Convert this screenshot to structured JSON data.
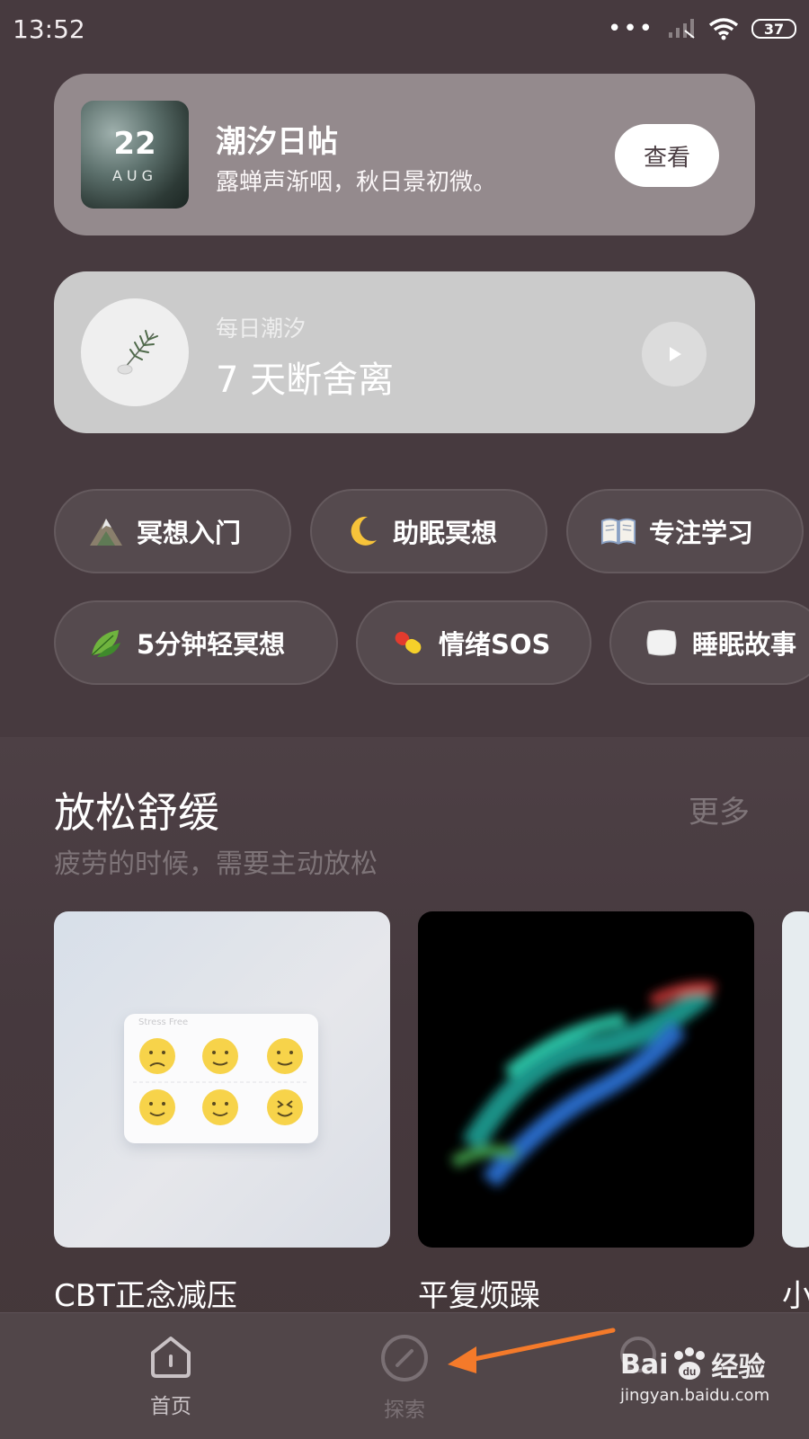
{
  "status": {
    "time": "13:52",
    "battery": "37"
  },
  "daily_card": {
    "day": "22",
    "month": "AUG",
    "title": "潮汐日帖",
    "subtitle": "露蝉声渐咽，秋日景初微。",
    "button": "查看"
  },
  "daily_tide": {
    "kicker": "每日潮汐",
    "title": "7 天断舍离"
  },
  "chips": [
    {
      "label": "冥想入门",
      "icon": "mountain-icon"
    },
    {
      "label": "助眠冥想",
      "icon": "moon-icon"
    },
    {
      "label": "专注学习",
      "icon": "book-icon"
    },
    {
      "label": "5分钟轻冥想",
      "icon": "leaf-icon"
    },
    {
      "label": "情绪SOS",
      "icon": "pill-icon"
    },
    {
      "label": "睡眠故事",
      "icon": "pillow-icon"
    }
  ],
  "section": {
    "title": "放松舒缓",
    "more": "更多",
    "subtitle": "疲劳的时候，需要主动放松"
  },
  "tiles": [
    {
      "label": "CBT正念减压",
      "inner_text": "Stress Free"
    },
    {
      "label": "平复烦躁"
    },
    {
      "label": "小"
    }
  ],
  "tabs": [
    {
      "label": "首页",
      "icon": "home-icon"
    },
    {
      "label": "探索",
      "icon": "compass-icon"
    }
  ],
  "watermark": {
    "brand": "Bai",
    "brand2": "经验",
    "url": "jingyan.baidu.com"
  },
  "colors": {
    "background": "#473a3f",
    "accent_arrow": "#f47a2a"
  }
}
